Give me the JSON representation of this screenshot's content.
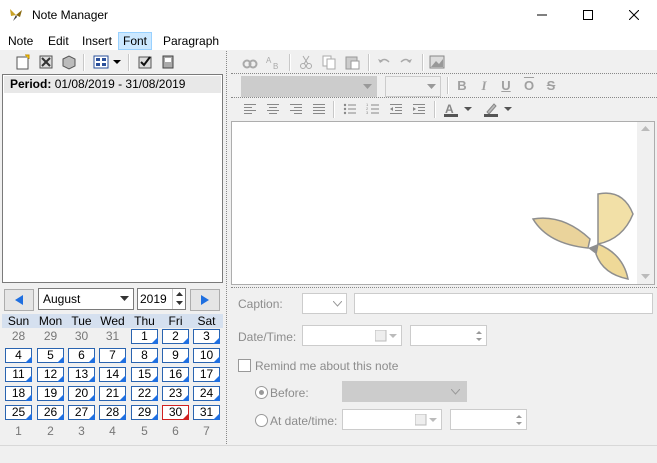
{
  "window": {
    "title": "Note Manager"
  },
  "menu": {
    "items": [
      "Note",
      "Edit",
      "Insert",
      "Font",
      "Paragraph"
    ],
    "active": "Font"
  },
  "list": {
    "period_label": "Period:",
    "period_value": "01/08/2019 - 31/08/2019"
  },
  "calendar": {
    "month": "August",
    "year": "2019",
    "weekdays": [
      "Sun",
      "Mon",
      "Tue",
      "Wed",
      "Thu",
      "Fri",
      "Sat"
    ],
    "weeks": [
      [
        "28",
        "29",
        "30",
        "31",
        "1",
        "2",
        "3"
      ],
      [
        "4",
        "5",
        "6",
        "7",
        "8",
        "9",
        "10"
      ],
      [
        "11",
        "12",
        "13",
        "14",
        "15",
        "16",
        "17"
      ],
      [
        "18",
        "19",
        "20",
        "21",
        "22",
        "23",
        "24"
      ],
      [
        "25",
        "26",
        "27",
        "28",
        "29",
        "30",
        "31"
      ],
      [
        "1",
        "2",
        "3",
        "4",
        "5",
        "6",
        "7"
      ]
    ],
    "today": "30"
  },
  "form": {
    "caption_label": "Caption:",
    "datetime_label": "Date/Time:",
    "remind_label": "Remind me about this note",
    "before_label": "Before:",
    "at_label": "At date/time:"
  },
  "colors": {
    "accent": "#1f6fe0",
    "today": "#d02020",
    "header": "#d5e0ef"
  }
}
